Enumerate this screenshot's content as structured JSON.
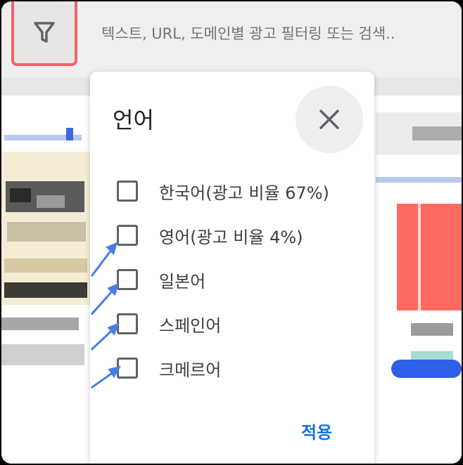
{
  "search": {
    "placeholder": "텍스트, URL, 도메인별 광고 필터링 또는 검색.."
  },
  "filter_button": {
    "icon": "filter-icon"
  },
  "dialog": {
    "title": "언어",
    "close_icon": "close-icon",
    "options": [
      {
        "label": "한국어(광고 비율 67%)",
        "checked": false
      },
      {
        "label": "영어(광고 비율 4%)",
        "checked": false
      },
      {
        "label": "일본어",
        "checked": false
      },
      {
        "label": "스페인어",
        "checked": false
      },
      {
        "label": "크메르어",
        "checked": false
      }
    ],
    "apply_label": "적용"
  },
  "colors": {
    "highlight_border": "#f0646a",
    "accent": "#1a73e8",
    "arrow": "#4a7dea"
  }
}
